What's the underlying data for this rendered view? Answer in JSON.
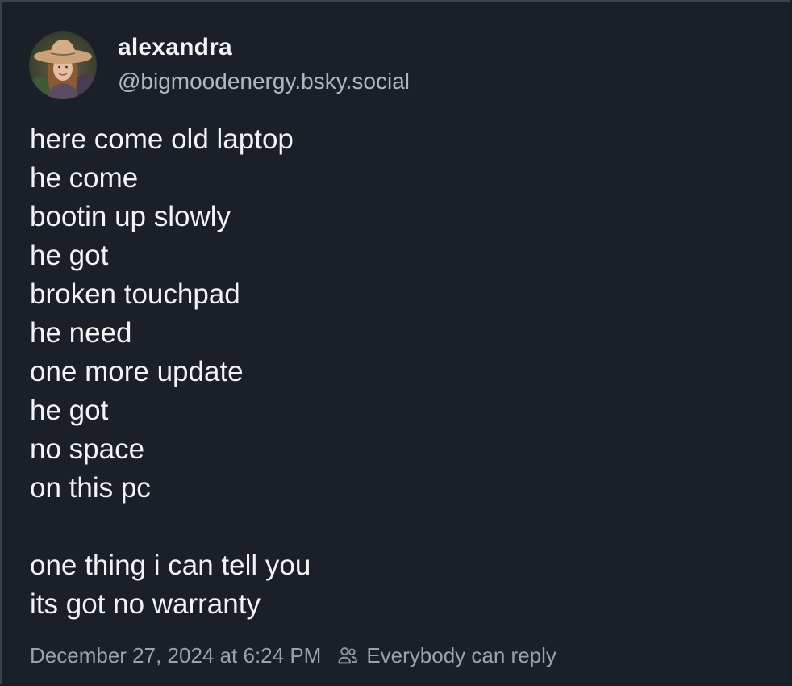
{
  "author": {
    "display_name": "alexandra",
    "handle": "@bigmoodenergy.bsky.social"
  },
  "post": {
    "lines": [
      "here come old laptop",
      "he come",
      "bootin up slowly",
      "he got",
      "broken touchpad",
      "he need",
      "one more update",
      "he got",
      "no space",
      "on this pc",
      "",
      "one thing i can tell you",
      "its got no warranty"
    ]
  },
  "footer": {
    "timestamp": "December 27, 2024 at 6:24 PM",
    "reply_setting_icon": "people-icon",
    "reply_setting": "Everybody can reply"
  },
  "colors": {
    "background": "#1b1f27",
    "text_primary": "#f1f3f5",
    "text_secondary": "#98a3b1",
    "border": "#3a4352"
  }
}
